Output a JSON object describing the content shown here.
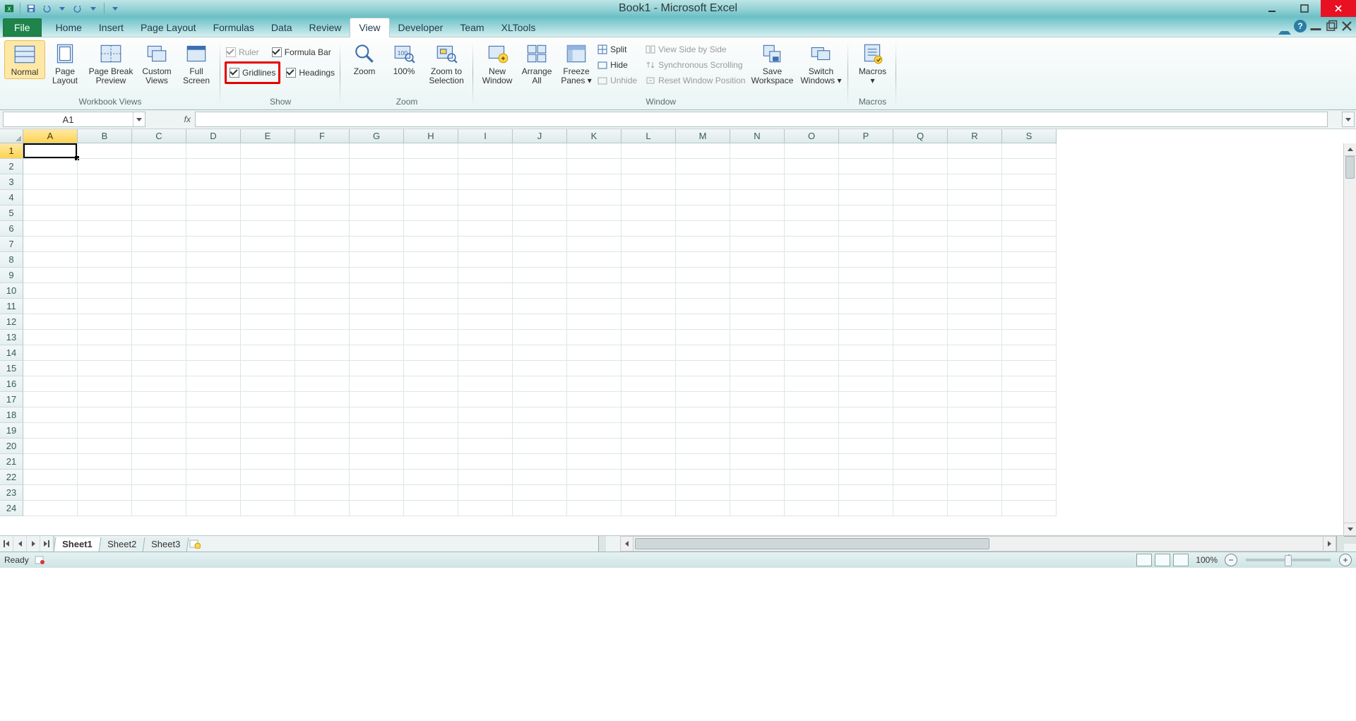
{
  "title": "Book1 - Microsoft Excel",
  "tabs": {
    "file": "File",
    "list": [
      "Home",
      "Insert",
      "Page Layout",
      "Formulas",
      "Data",
      "Review",
      "View",
      "Developer",
      "Team",
      "XLTools"
    ],
    "active_index": 6
  },
  "ribbon": {
    "groups": {
      "workbook_views": {
        "label": "Workbook Views",
        "normal": "Normal",
        "page_layout": "Page\nLayout",
        "page_break": "Page Break\nPreview",
        "custom_views": "Custom\nViews",
        "full_screen": "Full\nScreen"
      },
      "show": {
        "label": "Show",
        "ruler": "Ruler",
        "formula_bar": "Formula Bar",
        "gridlines": "Gridlines",
        "headings": "Headings"
      },
      "zoom": {
        "label": "Zoom",
        "zoom": "Zoom",
        "hundred": "100%",
        "to_selection": "Zoom to\nSelection"
      },
      "window": {
        "label": "Window",
        "new_window": "New\nWindow",
        "arrange_all": "Arrange\nAll",
        "freeze_panes": "Freeze\nPanes ▾",
        "split": "Split",
        "hide": "Hide",
        "unhide": "Unhide",
        "side_by_side": "View Side by Side",
        "sync_scroll": "Synchronous Scrolling",
        "reset_pos": "Reset Window Position",
        "save_workspace": "Save\nWorkspace",
        "switch_windows": "Switch\nWindows ▾"
      },
      "macros": {
        "label": "Macros",
        "macros": "Macros\n▾"
      }
    }
  },
  "name_box": "A1",
  "fx_label": "fx",
  "columns": [
    "A",
    "B",
    "C",
    "D",
    "E",
    "F",
    "G",
    "H",
    "I",
    "J",
    "K",
    "L",
    "M",
    "N",
    "O",
    "P",
    "Q",
    "R",
    "S"
  ],
  "rows": [
    1,
    2,
    3,
    4,
    5,
    6,
    7,
    8,
    9,
    10,
    11,
    12,
    13,
    14,
    15,
    16,
    17,
    18,
    19,
    20,
    21,
    22,
    23,
    24
  ],
  "selected_cell": {
    "col": "A",
    "row": 1
  },
  "sheets": [
    "Sheet1",
    "Sheet2",
    "Sheet3"
  ],
  "active_sheet_index": 0,
  "status": {
    "left": "Ready",
    "zoom": "100%"
  }
}
